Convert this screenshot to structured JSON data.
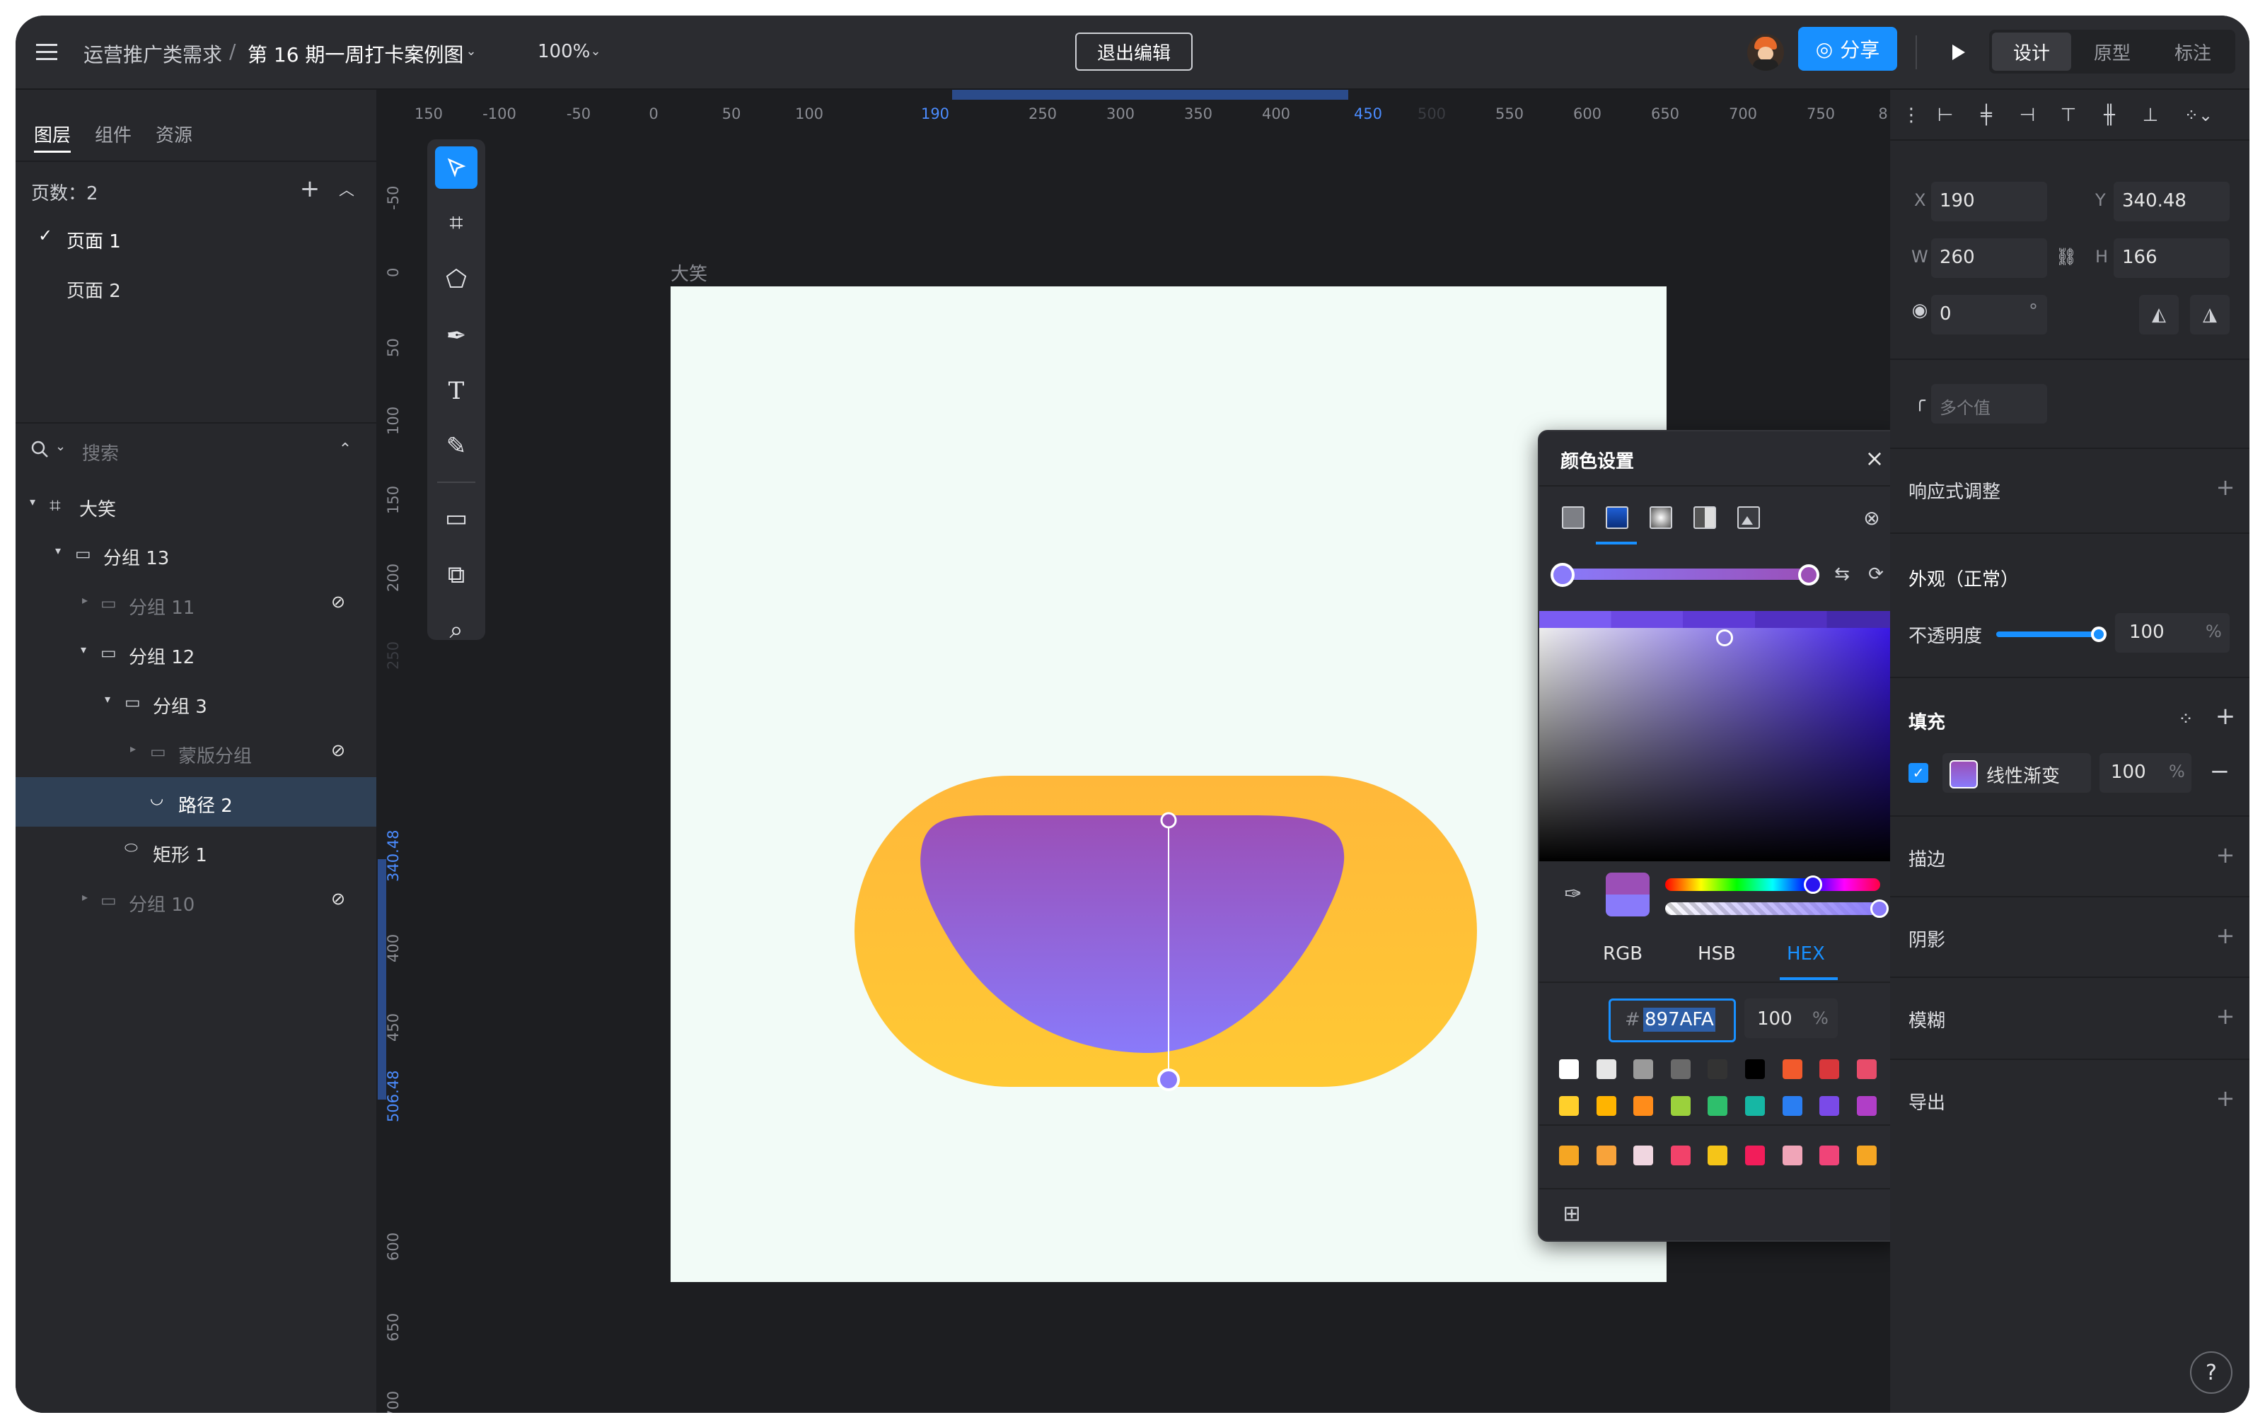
{
  "topbar": {
    "project": "运营推广类需求",
    "separator": "/",
    "file": "第 16 期一周打卡案例图",
    "zoom": "100%",
    "exit_edit": "退出编辑",
    "share": "分享",
    "modes": [
      "设计",
      "原型",
      "标注"
    ]
  },
  "left": {
    "tabs": [
      "图层",
      "组件",
      "资源"
    ],
    "page_count": "页数：2",
    "pages": [
      "页面 1",
      "页面 2"
    ],
    "search_placeholder": "搜索",
    "layers": [
      "大笑",
      "分组 13",
      "分组 11",
      "分组 12",
      "分组 3",
      "蒙版分组",
      "路径 2",
      "矩形 1",
      "分组 10"
    ]
  },
  "canvas": {
    "frame_label": "大笑",
    "hruler": [
      "150",
      "-100",
      "-50",
      "0",
      "50",
      "100",
      "190",
      "250",
      "300",
      "350",
      "400",
      "450",
      "500",
      "550",
      "600",
      "650",
      "700",
      "750",
      "8"
    ],
    "vruler": [
      "-50",
      "0",
      "50",
      "100",
      "150",
      "200",
      "250",
      "340.48",
      "400",
      "450",
      "506.48",
      "600",
      "650",
      "700"
    ]
  },
  "colorpanel": {
    "title": "颜色设置",
    "modes": [
      "RGB",
      "HSB",
      "HEX"
    ],
    "hash": "#",
    "hex": "897AFA",
    "opacity": "100",
    "percent": "%",
    "swatches_row1": [
      "#ffffff",
      "#e6e6e6",
      "#9a9a9a",
      "#6a6a6a",
      "#333333",
      "#000000",
      "#f25a2c",
      "#d9373b",
      "#e84c6a"
    ],
    "swatches_row2": [
      "#ffd02b",
      "#ffb400",
      "#ff8c1a",
      "#9bd13c",
      "#2ebf6c",
      "#16b7a4",
      "#2a7ef2",
      "#7a4ae8",
      "#b03ec7"
    ],
    "swatches_row3": [
      "#f5a623",
      "#f8a33a",
      "#f0d6e0",
      "#f2426a",
      "#f5c518",
      "#f21d5a",
      "#f0a5b8",
      "#f04478",
      "#f5a623"
    ]
  },
  "right": {
    "x_label": "X",
    "x_value": "190",
    "y_label": "Y",
    "y_value": "340.48",
    "w_label": "W",
    "w_value": "260",
    "h_label": "H",
    "h_value": "166",
    "rotation": "0",
    "degree": "°",
    "radius_placeholder": "多个值",
    "responsive": "响应式调整",
    "appearance": "外观（正常）",
    "opacity_label": "不透明度",
    "opacity_value": "100",
    "opacity_level": 1.0,
    "percent": "%",
    "fill": "填充",
    "fill_type": "线性渐变",
    "fill_opacity": "100",
    "stroke": "描边",
    "shadow": "阴影",
    "blur": "模糊",
    "export": "导出",
    "help": "?"
  },
  "colors": {
    "accent": "#1890ff",
    "gradient_start": "#9b4fb7",
    "gradient_end": "#897AFA",
    "pill": "#ffbf33",
    "frame_bg": "#f2fbf7"
  }
}
